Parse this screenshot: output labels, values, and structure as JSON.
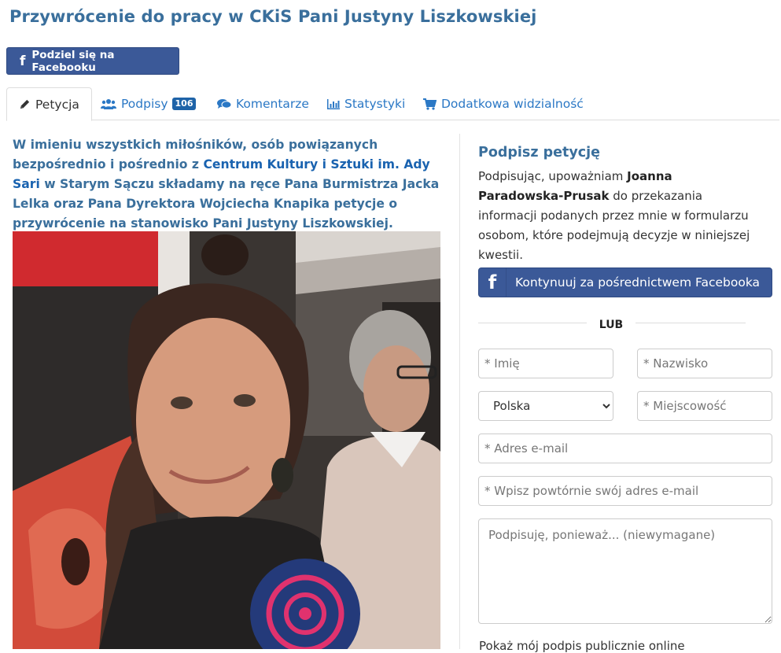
{
  "petition": {
    "title": "Przywrócenie do pracy w CKiS Pani Justyny Liszkowskiej",
    "share_button": "Podziel się na Facebooku",
    "intro": {
      "part1": "W imieniu wszystkich miłośników, osób powiązanych bezpośrednio i pośrednio z ",
      "link": "Centrum Kultury i Sztuki im. Ady Sari",
      "part2": " w Starym Sączu składamy na ręce Pana Burmistrza Jacka Lelka oraz Pana Dyrektora Wojciecha Knapika petycje o przywrócenie na stanowisko Pani Justyny Liszkowskiej."
    }
  },
  "tabs": [
    {
      "label": "Petycja",
      "icon": "pencil-icon",
      "active": true
    },
    {
      "label": "Podpisy",
      "icon": "users-icon",
      "badge": "106"
    },
    {
      "label": "Komentarze",
      "icon": "comments-icon"
    },
    {
      "label": "Statystyki",
      "icon": "bar-chart-icon"
    },
    {
      "label": "Dodatkowa widzialność",
      "icon": "cart-icon"
    }
  ],
  "sign": {
    "title": "Podpisz petycję",
    "desc_before": "Podpisując, upoważniam ",
    "desc_name": "Joanna Paradowska-Prusak",
    "desc_after": " do przekazania informacji podanych przez mnie w formularzu osobom, które podejmują decyzje w niniejszej kwestii.",
    "fb_continue": "Kontynuuj za pośrednictwem Facebooka",
    "or_text": "LUB",
    "fields": {
      "first_name": "* Imię",
      "last_name": "* Nazwisko",
      "country_selected": "Polska",
      "city": "* Miejscowość",
      "email": "* Adres e-mail",
      "email_repeat": "* Wpisz powtórnie swój adres e-mail",
      "comment": "Podpisuję, ponieważ... (niewymagane)"
    },
    "public_label": "Pokaż mój podpis publicznie online"
  },
  "colors": {
    "title": "#3a6f9c",
    "link": "#2b78c5",
    "facebook": "#3b5998",
    "badge": "#1e63a8"
  }
}
